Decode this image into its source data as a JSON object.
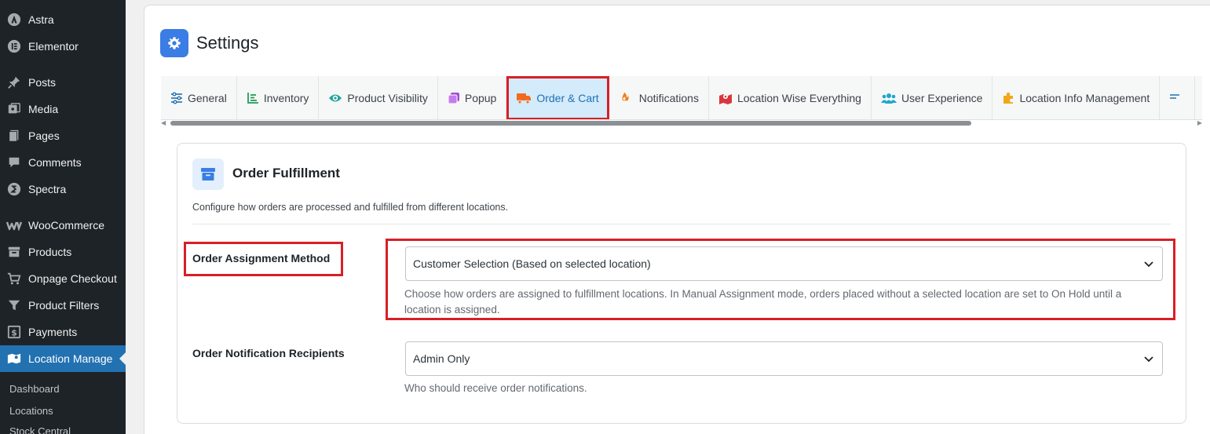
{
  "sidebar": {
    "menu": [
      {
        "label": "Astra",
        "icon": "astra-icon"
      },
      {
        "label": "Elementor",
        "icon": "elementor-icon"
      },
      {
        "label": "Posts",
        "icon": "pushpin-icon"
      },
      {
        "label": "Media",
        "icon": "media-icon"
      },
      {
        "label": "Pages",
        "icon": "pages-icon"
      },
      {
        "label": "Comments",
        "icon": "comment-icon"
      },
      {
        "label": "Spectra",
        "icon": "spectra-icon"
      },
      {
        "label": "WooCommerce",
        "icon": "woocommerce-icon"
      },
      {
        "label": "Products",
        "icon": "archive-icon"
      },
      {
        "label": "Onpage Checkout",
        "icon": "cart-icon"
      },
      {
        "label": "Product Filters",
        "icon": "filter-icon"
      },
      {
        "label": "Payments",
        "icon": "dollar-icon"
      },
      {
        "label": "Location Manage",
        "icon": "map-icon"
      }
    ],
    "submenu": [
      {
        "label": "Dashboard"
      },
      {
        "label": "Locations"
      },
      {
        "label": "Stock Central"
      }
    ]
  },
  "header": {
    "title": "Settings",
    "icon": "gear-icon",
    "accent": "#3a7de4"
  },
  "tabs": [
    {
      "label": "General",
      "icon": "sliders-icon"
    },
    {
      "label": "Inventory",
      "icon": "bar-chart-icon"
    },
    {
      "label": "Product Visibility",
      "icon": "eye-icon"
    },
    {
      "label": "Popup",
      "icon": "popup-icon"
    },
    {
      "label": "Order & Cart",
      "icon": "truck-icon",
      "active": true
    },
    {
      "label": "Notifications",
      "icon": "flame-icon"
    },
    {
      "label": "Location Wise Everything",
      "icon": "map-marker-icon"
    },
    {
      "label": "User Experience",
      "icon": "users-icon"
    },
    {
      "label": "Location Info Management",
      "icon": "puzzle-icon"
    }
  ],
  "card": {
    "icon": "archive-box-icon",
    "title": "Order Fulfillment",
    "description": "Configure how orders are processed and fulfilled from different locations."
  },
  "fields": {
    "assignment": {
      "label": "Order Assignment Method",
      "value": "Customer Selection (Based on selected location)",
      "help": "Choose how orders are assigned to fulfillment locations. In Manual Assignment mode, orders placed without a selected location are set to On Hold until a location is assigned."
    },
    "recipients": {
      "label": "Order Notification Recipients",
      "value": "Admin Only",
      "help": "Who should receive order notifications."
    }
  },
  "colors": {
    "highlight": "#d81f26",
    "active_tab_bg": "#d3ebfb",
    "sidebar_bg": "#1d2327",
    "sidebar_active": "#2271b1"
  }
}
